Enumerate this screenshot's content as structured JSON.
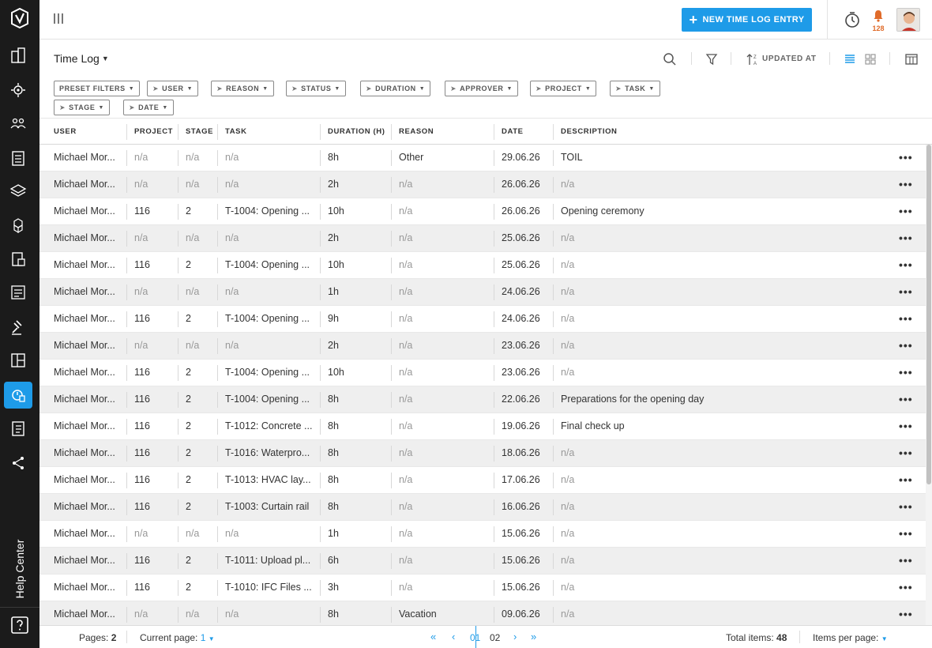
{
  "sidebar": {
    "items": [
      {
        "icon": "buildings-icon"
      },
      {
        "icon": "gear-building-icon"
      },
      {
        "icon": "users-icon"
      },
      {
        "icon": "clipboard-list-icon"
      },
      {
        "icon": "layers-icon"
      },
      {
        "icon": "cubes-icon"
      },
      {
        "icon": "document-box-icon"
      },
      {
        "icon": "checklist-icon"
      },
      {
        "icon": "gavel-icon"
      },
      {
        "icon": "layout-icon"
      },
      {
        "icon": "time-log-icon",
        "active": true
      },
      {
        "icon": "notebook-icon"
      },
      {
        "icon": "share-icon"
      }
    ],
    "help_label": "Help Center",
    "active_color": "#1e9be8"
  },
  "header": {
    "new_button_label": "NEW TIME LOG ENTRY",
    "notification_count": "128",
    "accent": "#1e9be8",
    "badge_color": "#e06b2a"
  },
  "toolbar": {
    "title": "Time Log",
    "sort_label": "UPDATED AT"
  },
  "filters": [
    "PRESET FILTERS",
    "USER",
    "REASON",
    "STATUS",
    "DURATION",
    "APPROVER",
    "PROJECT",
    "TASK",
    "STAGE",
    "DATE"
  ],
  "table": {
    "columns": [
      "USER",
      "PROJECT",
      "STAGE",
      "TASK",
      "DURATION (H)",
      "REASON",
      "DATE",
      "DESCRIPTION"
    ],
    "rows": [
      [
        "Michael Mor...",
        "n/a",
        "n/a",
        "n/a",
        "8h",
        "Other",
        "29.06.26",
        "TOIL"
      ],
      [
        "Michael Mor...",
        "n/a",
        "n/a",
        "n/a",
        "2h",
        "n/a",
        "26.06.26",
        "n/a"
      ],
      [
        "Michael Mor...",
        "116",
        "2",
        "T-1004: Opening ...",
        "10h",
        "n/a",
        "26.06.26",
        "Opening ceremony"
      ],
      [
        "Michael Mor...",
        "n/a",
        "n/a",
        "n/a",
        "2h",
        "n/a",
        "25.06.26",
        "n/a"
      ],
      [
        "Michael Mor...",
        "116",
        "2",
        "T-1004: Opening ...",
        "10h",
        "n/a",
        "25.06.26",
        "n/a"
      ],
      [
        "Michael Mor...",
        "n/a",
        "n/a",
        "n/a",
        "1h",
        "n/a",
        "24.06.26",
        "n/a"
      ],
      [
        "Michael Mor...",
        "116",
        "2",
        "T-1004: Opening ...",
        "9h",
        "n/a",
        "24.06.26",
        "n/a"
      ],
      [
        "Michael Mor...",
        "n/a",
        "n/a",
        "n/a",
        "2h",
        "n/a",
        "23.06.26",
        "n/a"
      ],
      [
        "Michael Mor...",
        "116",
        "2",
        "T-1004: Opening ...",
        "10h",
        "n/a",
        "23.06.26",
        "n/a"
      ],
      [
        "Michael Mor...",
        "116",
        "2",
        "T-1004: Opening ...",
        "8h",
        "n/a",
        "22.06.26",
        "Preparations for the opening day"
      ],
      [
        "Michael Mor...",
        "116",
        "2",
        "T-1012: Concrete ...",
        "8h",
        "n/a",
        "19.06.26",
        "Final check up"
      ],
      [
        "Michael Mor...",
        "116",
        "2",
        "T-1016: Waterpro...",
        "8h",
        "n/a",
        "18.06.26",
        "n/a"
      ],
      [
        "Michael Mor...",
        "116",
        "2",
        "T-1013: HVAC lay...",
        "8h",
        "n/a",
        "17.06.26",
        "n/a"
      ],
      [
        "Michael Mor...",
        "116",
        "2",
        "T-1003: Curtain rail",
        "8h",
        "n/a",
        "16.06.26",
        "n/a"
      ],
      [
        "Michael Mor...",
        "n/a",
        "n/a",
        "n/a",
        "1h",
        "n/a",
        "15.06.26",
        "n/a"
      ],
      [
        "Michael Mor...",
        "116",
        "2",
        "T-1011: Upload pl...",
        "6h",
        "n/a",
        "15.06.26",
        "n/a"
      ],
      [
        "Michael Mor...",
        "116",
        "2",
        "T-1010: IFC Files ...",
        "3h",
        "n/a",
        "15.06.26",
        "n/a"
      ],
      [
        "Michael Mor...",
        "n/a",
        "n/a",
        "n/a",
        "8h",
        "Vacation",
        "09.06.26",
        "n/a"
      ]
    ],
    "row_menu": "•••"
  },
  "footer": {
    "pages_label": "Pages:",
    "pages_value": "2",
    "current_page_label": "Current page:",
    "current_page_value": "1",
    "page_numbers": [
      "01",
      "02"
    ],
    "total_label": "Total items:",
    "total_value": "48",
    "per_page_label": "Items per page:"
  }
}
